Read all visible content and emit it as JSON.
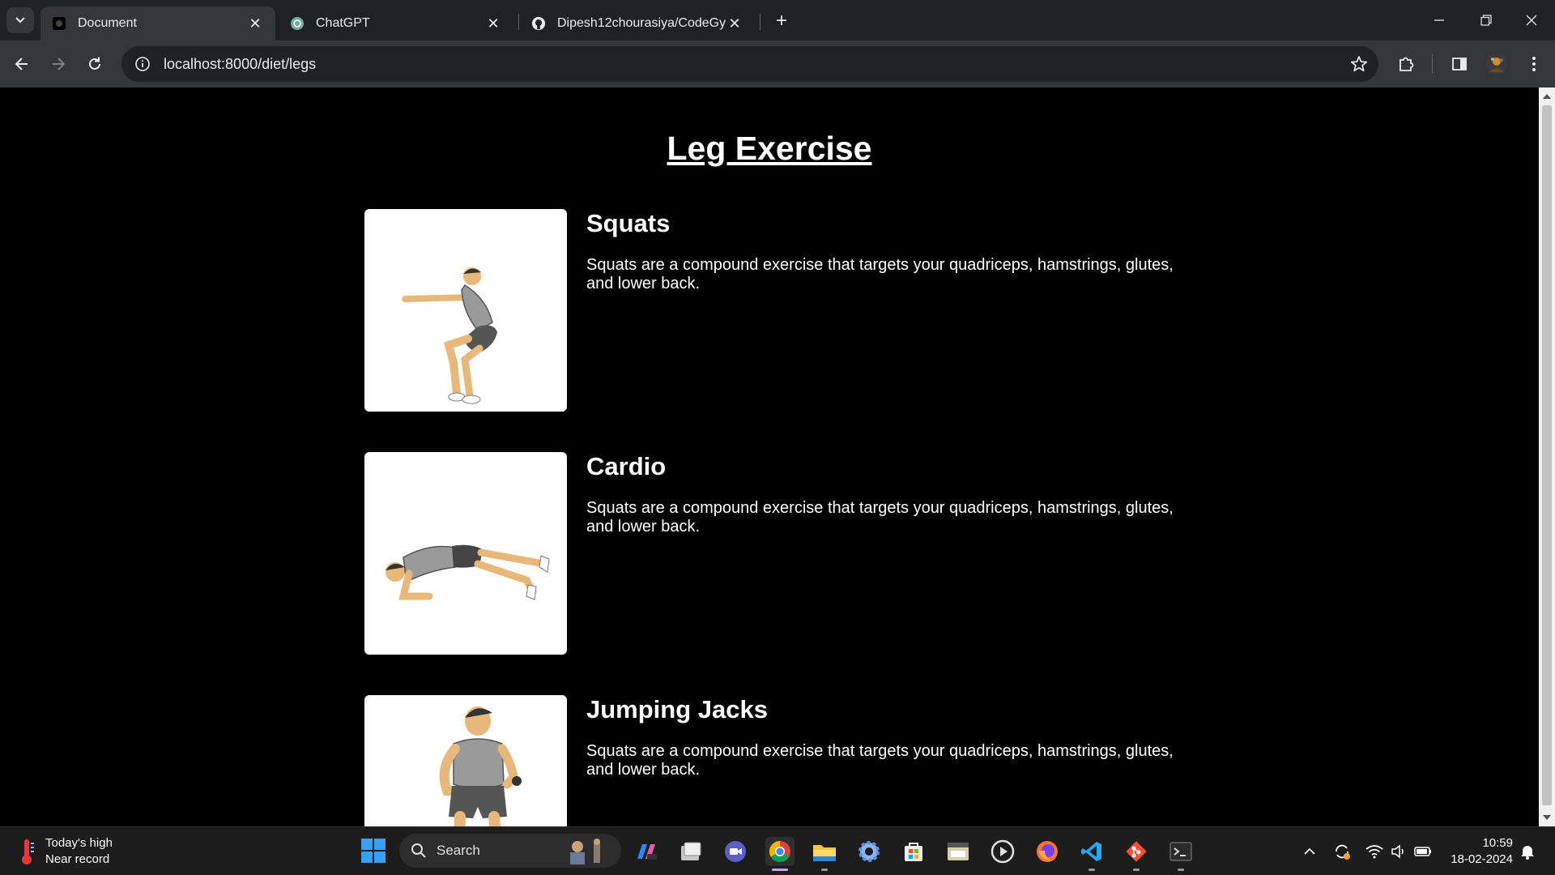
{
  "browser": {
    "tabs": [
      {
        "title": "Document",
        "icon": "document-favicon"
      },
      {
        "title": "ChatGPT",
        "icon": "chatgpt-icon"
      },
      {
        "title": "Dipesh12chourasiya/CodeGym",
        "icon": "github-icon"
      }
    ],
    "url": "localhost:8000/diet/legs"
  },
  "page": {
    "title": "Leg Exercise",
    "exercises": [
      {
        "name": "Squats",
        "description": "Squats are a compound exercise that targets your quadriceps, hamstrings, glutes, and lower back."
      },
      {
        "name": "Cardio",
        "description": "Squats are a compound exercise that targets your quadriceps, hamstrings, glutes, and lower back."
      },
      {
        "name": "Jumping Jacks",
        "description": "Squats are a compound exercise that targets your quadriceps, hamstrings, glutes, and lower back."
      }
    ]
  },
  "taskbar": {
    "weather_line1": "Today's high",
    "weather_line2": "Near record",
    "search_label": "Search",
    "time": "10:59",
    "date": "18-02-2024"
  }
}
